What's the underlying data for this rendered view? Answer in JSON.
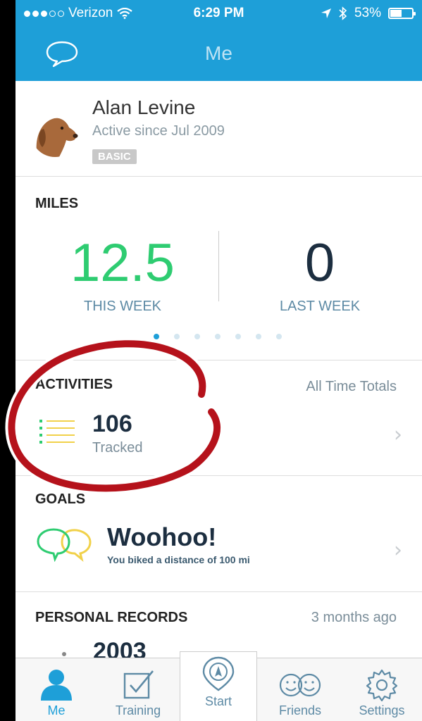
{
  "status_bar": {
    "carrier": "Verizon",
    "time": "6:29 PM",
    "battery": "53%",
    "battery_level": 0.53
  },
  "nav": {
    "title": "Me",
    "left_icon": "chat-bubble-icon"
  },
  "profile": {
    "name": "Alan Levine",
    "active_since": "Active since Jul 2009",
    "badge": "BASIC"
  },
  "miles": {
    "heading": "MILES",
    "this_week_value": "12.5",
    "this_week_label": "THIS WEEK",
    "last_week_value": "0",
    "last_week_label": "LAST WEEK",
    "page_count": 7,
    "current_page": 1
  },
  "activities": {
    "heading": "ACTIVITIES",
    "right_label": "All Time Totals",
    "count": "106",
    "count_label": "Tracked"
  },
  "goals": {
    "heading": "GOALS",
    "title": "Woohoo!",
    "subtitle": "You biked a distance of 100 mi"
  },
  "personal_records": {
    "heading": "PERSONAL RECORDS",
    "right_label": "3 months ago",
    "value": "2003"
  },
  "tabs": [
    {
      "label": "Me",
      "icon": "person-icon",
      "active": true
    },
    {
      "label": "Training",
      "icon": "checkbox-icon",
      "active": false
    },
    {
      "label": "Start",
      "icon": "location-pin-icon",
      "active": false
    },
    {
      "label": "Friends",
      "icon": "smiley-faces-icon",
      "active": false
    },
    {
      "label": "Settings",
      "icon": "gear-icon",
      "active": false
    }
  ],
  "colors": {
    "accent": "#1e9fd8",
    "green": "#2ecc71",
    "dark_text": "#1c2e40",
    "annotation_red": "#b5121b"
  }
}
